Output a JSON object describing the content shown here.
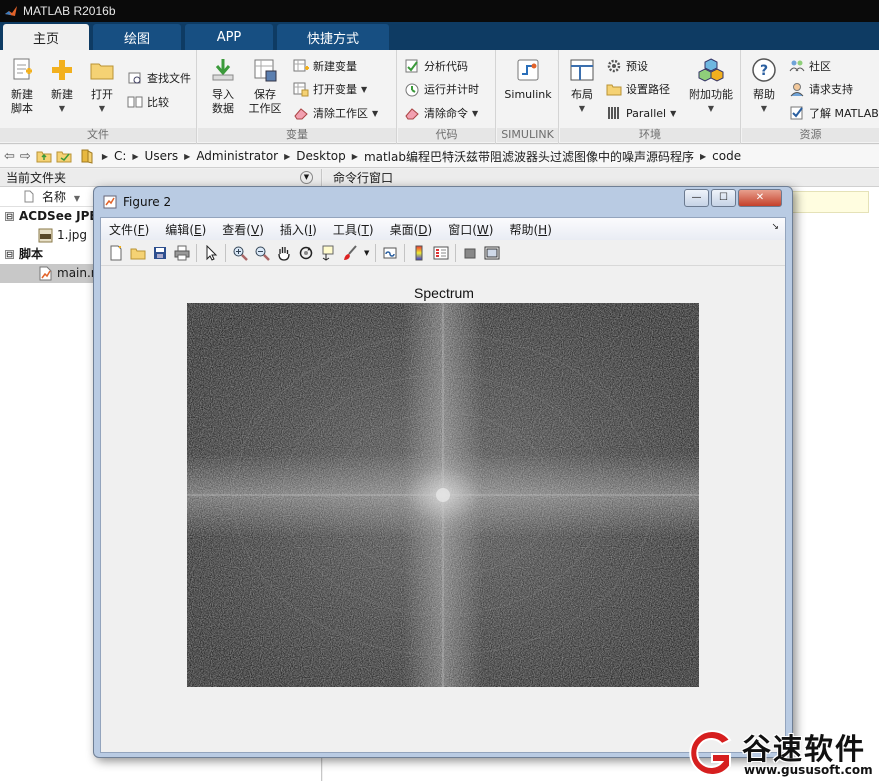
{
  "app": {
    "title": "MATLAB R2016b"
  },
  "tabs": [
    {
      "label": "主页",
      "active": true
    },
    {
      "label": "绘图"
    },
    {
      "label": "APP"
    },
    {
      "label": "快捷方式"
    }
  ],
  "ribbon": {
    "file": {
      "label": "文件",
      "new_script": "新建\n脚本",
      "new": "新建",
      "open": "打开",
      "find_files": "查找文件",
      "compare": "比较"
    },
    "variable": {
      "label": "变量",
      "import": "导入\n数据",
      "save_ws": "保存\n工作区",
      "new_var": "新建变量",
      "open_var": "打开变量",
      "clear_ws": "清除工作区"
    },
    "code": {
      "label": "代码",
      "analyze": "分析代码",
      "run_time": "运行并计时",
      "clear_cmd": "清除命令"
    },
    "simulink": {
      "label": "SIMULINK",
      "btn": "Simulink"
    },
    "environment": {
      "label": "环境",
      "layout": "布局",
      "prefs": "预设",
      "set_path": "设置路径",
      "parallel": "Parallel",
      "addons": "附加功能"
    },
    "resources": {
      "label": "资源",
      "help": "帮助",
      "community": "社区",
      "support": "请求支持",
      "learn": "了解 MATLAB"
    }
  },
  "address": {
    "crumbs": [
      "C:",
      "Users",
      "Administrator",
      "Desktop",
      "matlab编程巴特沃兹带阻滤波器头过滤图像中的噪声源码程序",
      "code"
    ]
  },
  "left_panel": {
    "title": "当前文件夹",
    "column": "名称",
    "tree": [
      {
        "label": "ACDSee JPE",
        "bold": true,
        "expander": "⊟"
      },
      {
        "label": "1.jpg",
        "bold": false
      },
      {
        "label": "脚本",
        "bold": true,
        "expander": "⊟"
      },
      {
        "label": "main.m",
        "bold": false,
        "selected": true
      }
    ]
  },
  "right_panel": {
    "title": "命令行窗口"
  },
  "figure": {
    "title": "Figure 2",
    "menus": [
      {
        "label": "文件",
        "key": "F"
      },
      {
        "label": "编辑",
        "key": "E"
      },
      {
        "label": "查看",
        "key": "V"
      },
      {
        "label": "插入",
        "key": "I"
      },
      {
        "label": "工具",
        "key": "T"
      },
      {
        "label": "桌面",
        "key": "D"
      },
      {
        "label": "窗口",
        "key": "W"
      },
      {
        "label": "帮助",
        "key": "H"
      }
    ],
    "plot_title": "Spectrum"
  },
  "watermark": {
    "brand": "谷速软件",
    "url": "www.gususoft.com"
  },
  "colors": {
    "tab_bg": "#0e3b63",
    "tab_inactive": "#174f82",
    "title_bg": "#0a0a0a",
    "fig_frame": "#b9cbe3"
  }
}
